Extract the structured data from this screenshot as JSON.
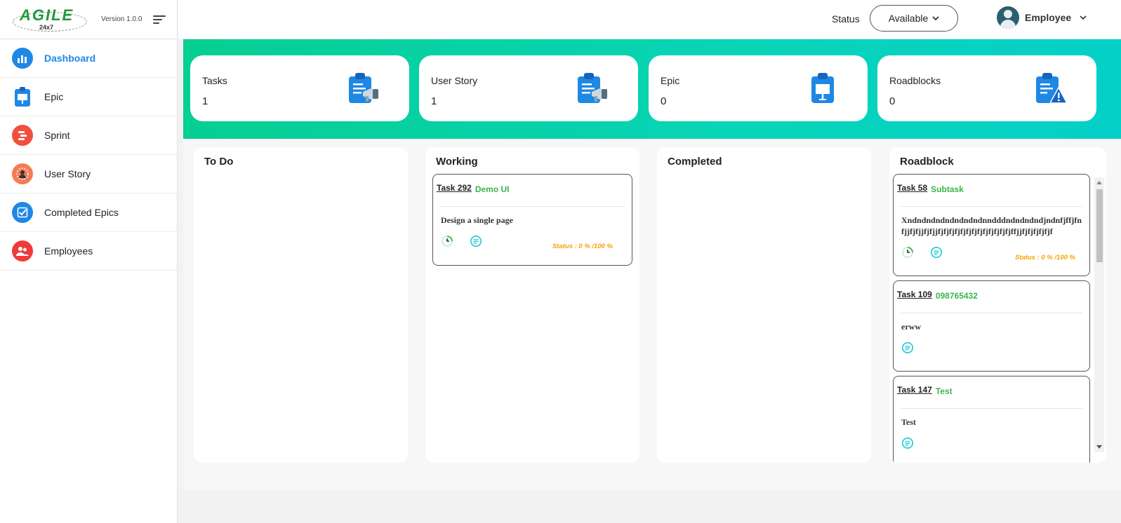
{
  "brand": {
    "logo_text": "AGILE",
    "logo_sub": "24x7",
    "version": "Version 1.0.0"
  },
  "sidebar": {
    "items": [
      {
        "label": "Dashboard",
        "icon": "chart-bars-icon",
        "color": "#1e88e5",
        "active": true
      },
      {
        "label": "Epic",
        "icon": "clipboard-presentation-icon",
        "color": "#1e88e5",
        "active": false
      },
      {
        "label": "Sprint",
        "icon": "sprint-blocks-icon",
        "color": "#f04e3e",
        "active": false
      },
      {
        "label": "User Story",
        "icon": "user-circle-icon",
        "color": "#f47c55",
        "active": false
      },
      {
        "label": "Completed Epics",
        "icon": "checkbox-icon",
        "color": "#1e88e5",
        "active": false
      },
      {
        "label": "Employees",
        "icon": "people-icon",
        "color": "#f03a3a",
        "active": false
      }
    ]
  },
  "topbar": {
    "status_label": "Status",
    "status_value": "Available",
    "user_name": "Employee"
  },
  "stats": [
    {
      "title": "Tasks",
      "value": "1",
      "icon": "clipboard-megaphone-icon"
    },
    {
      "title": "User Story",
      "value": "1",
      "icon": "clipboard-megaphone-icon"
    },
    {
      "title": "Epic",
      "value": "0",
      "icon": "clipboard-presentation-icon"
    },
    {
      "title": "Roadblocks",
      "value": "0",
      "icon": "clipboard-warning-icon"
    }
  ],
  "columns": {
    "todo": {
      "title": "To Do"
    },
    "working": {
      "title": "Working",
      "tasks": [
        {
          "id": "Task 292",
          "tag": "Demo UI",
          "desc": "Design a single page",
          "status": "Status : 0 % /100 %"
        }
      ]
    },
    "completed": {
      "title": "Completed"
    },
    "roadblock": {
      "title": "Roadblock",
      "tasks": [
        {
          "id": "Task 58",
          "tag": "Subtask",
          "desc": "Xndndndndndndndndnndddndndndndjndnfjffjfnfjjfjfjjfjfjjfjfjfjfjfjfjfjfjfjfjfjfjfjffjjfjfjfjfjfjf",
          "status": "Status : 0 % /100 %"
        },
        {
          "id": "Task 109",
          "tag": "098765432",
          "desc": "erww"
        },
        {
          "id": "Task 147",
          "tag": "Test",
          "desc": "Test"
        }
      ]
    }
  },
  "colors": {
    "accent": "#1e88e5",
    "banner_start": "#06cf92",
    "banner_end": "#05d0c8",
    "tag_green": "#3bb54a",
    "status_orange": "#f5a300"
  }
}
